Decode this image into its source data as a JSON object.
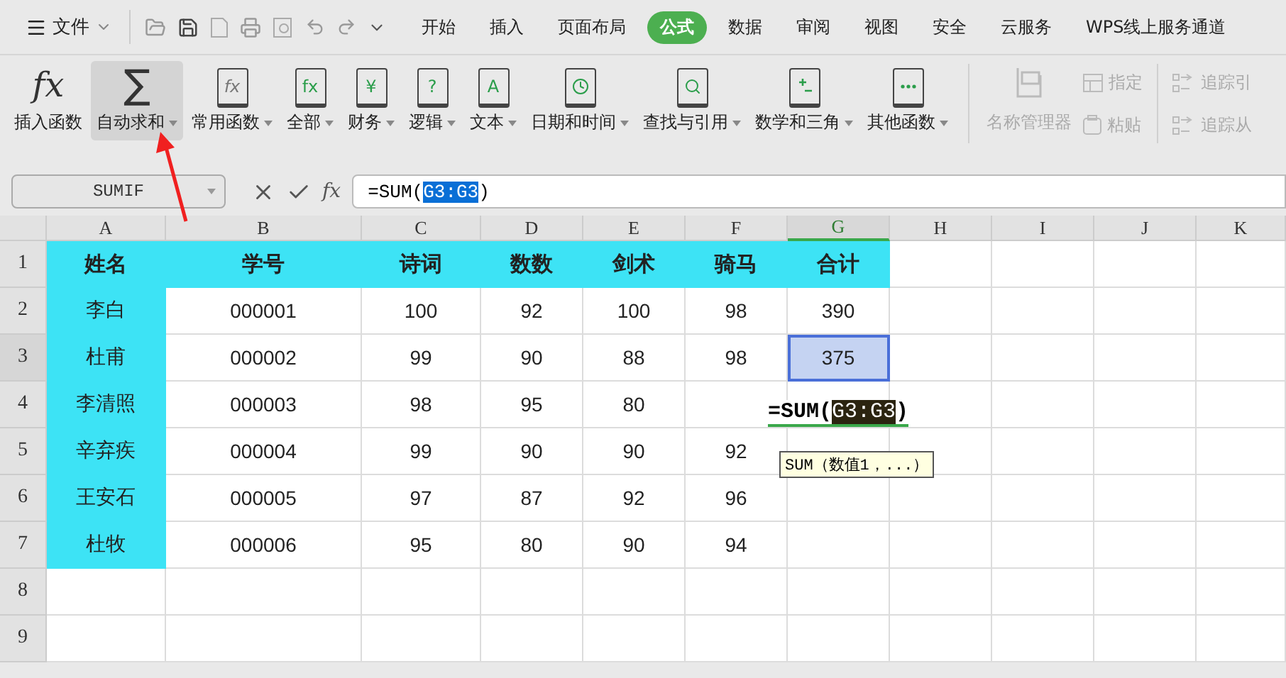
{
  "menu": {
    "file_label": "文件",
    "tabs": [
      {
        "label": "开始",
        "selected": false
      },
      {
        "label": "插入",
        "selected": false
      },
      {
        "label": "页面布局",
        "selected": false
      },
      {
        "label": "公式",
        "selected": true
      },
      {
        "label": "数据",
        "selected": false
      },
      {
        "label": "审阅",
        "selected": false
      },
      {
        "label": "视图",
        "selected": false
      },
      {
        "label": "安全",
        "selected": false
      },
      {
        "label": "云服务",
        "selected": false
      },
      {
        "label": "WPS线上服务通道",
        "selected": false
      }
    ]
  },
  "ribbon": {
    "buttons": [
      {
        "label": "插入函数",
        "kind": "plain",
        "glyph": "fx",
        "dropdown": false,
        "selected": false
      },
      {
        "label": "自动求和",
        "kind": "plain",
        "glyph": "∑",
        "dropdown": true,
        "selected": true
      },
      {
        "label": "常用函数",
        "kind": "star",
        "glyph": "fx",
        "dropdown": true,
        "selected": false
      },
      {
        "label": "全部",
        "kind": "book",
        "glyph": "fx",
        "dropdown": true,
        "selected": false
      },
      {
        "label": "财务",
        "kind": "book",
        "glyph": "¥",
        "dropdown": true,
        "selected": false
      },
      {
        "label": "逻辑",
        "kind": "book",
        "glyph": "?",
        "dropdown": true,
        "selected": false
      },
      {
        "label": "文本",
        "kind": "book",
        "glyph": "A",
        "dropdown": true,
        "selected": false
      },
      {
        "label": "日期和时间",
        "kind": "clock",
        "dropdown": true,
        "selected": false
      },
      {
        "label": "查找与引用",
        "kind": "search",
        "dropdown": true,
        "selected": false
      },
      {
        "label": "数学和三角",
        "kind": "calc",
        "dropdown": true,
        "selected": false
      },
      {
        "label": "其他函数",
        "kind": "more",
        "dropdown": true,
        "selected": false
      }
    ],
    "names": {
      "label": "名称管理器",
      "disabled": true
    },
    "small": [
      {
        "label": "指定",
        "kind": "grid",
        "disabled": true
      },
      {
        "label": "粘贴",
        "kind": "paste",
        "disabled": true
      },
      {
        "label": "追踪引",
        "kind": "trace",
        "disabled": true
      },
      {
        "label": "追踪从",
        "kind": "trace",
        "disabled": true
      }
    ]
  },
  "formula_bar": {
    "name_box": "SUMIF",
    "fx": "fx",
    "prefix": "=SUM(",
    "ref": "G3:G3",
    "suffix": ")"
  },
  "sheet": {
    "columns": [
      {
        "label": "A",
        "selected": false
      },
      {
        "label": "B",
        "selected": false
      },
      {
        "label": "C",
        "selected": false
      },
      {
        "label": "D",
        "selected": false
      },
      {
        "label": "E",
        "selected": false
      },
      {
        "label": "F",
        "selected": false
      },
      {
        "label": "G",
        "selected": true
      },
      {
        "label": "H",
        "selected": false
      },
      {
        "label": "I",
        "selected": false
      },
      {
        "label": "J",
        "selected": false
      },
      {
        "label": "K",
        "selected": false
      }
    ],
    "rows": [
      {
        "label": "1",
        "header": true,
        "selected": false,
        "cells": [
          "姓名",
          "学号",
          "诗词",
          "数数",
          "剑术",
          "骑马",
          "合计"
        ]
      },
      {
        "label": "2",
        "header": false,
        "selected": false,
        "cells": [
          "李白",
          "000001",
          "100",
          "92",
          "100",
          "98",
          "390"
        ]
      },
      {
        "label": "3",
        "header": false,
        "selected": true,
        "cells": [
          "杜甫",
          "000002",
          "99",
          "90",
          "88",
          "98",
          "375"
        ]
      },
      {
        "label": "4",
        "header": false,
        "selected": false,
        "cells": [
          "李清照",
          "000003",
          "98",
          "95",
          "80"
        ],
        "editor": {
          "prefix": "=SUM(",
          "ref": "G3:G3",
          "suffix": ")",
          "hint": "SUM（数值1，...）"
        }
      },
      {
        "label": "5",
        "header": false,
        "selected": false,
        "cells": [
          "辛弃疾",
          "000004",
          "99",
          "90",
          "90",
          "92"
        ]
      },
      {
        "label": "6",
        "header": false,
        "selected": false,
        "cells": [
          "王安石",
          "000005",
          "97",
          "87",
          "92",
          "96"
        ]
      },
      {
        "label": "7",
        "header": false,
        "selected": false,
        "cells": [
          "杜牧",
          "000006",
          "95",
          "80",
          "90",
          "94"
        ]
      },
      {
        "label": "8",
        "header": false,
        "selected": false
      },
      {
        "label": "9",
        "header": false,
        "selected": false
      }
    ]
  }
}
